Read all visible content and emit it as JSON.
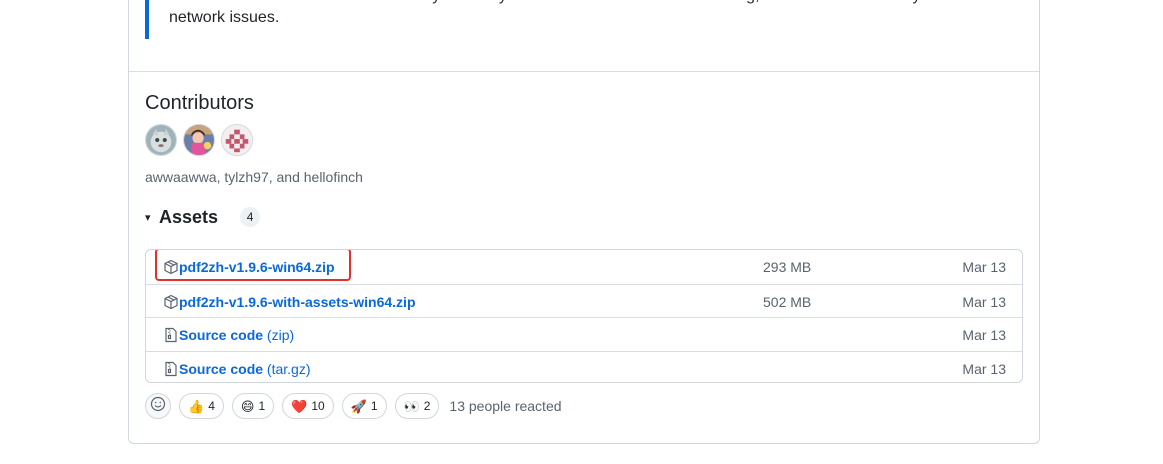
{
  "note": {
    "line1": "The version without assets will also dynamically download resources when running, but the download may fail due to",
    "line2": "network issues."
  },
  "contributors": {
    "title": "Contributors",
    "names": "awwaawwa, tylzh97, and hellofinch",
    "avatars": [
      "awwaawwa",
      "tylzh97",
      "hellofinch"
    ]
  },
  "assets": {
    "caret": "▾",
    "title": "Assets",
    "count": "4",
    "items": [
      {
        "name": "pdf2zh-v1.9.6-win64.zip",
        "suffix": "",
        "size": "293 MB",
        "date": "Mar 13",
        "icon": "package-icon"
      },
      {
        "name": "pdf2zh-v1.9.6-with-assets-win64.zip",
        "suffix": "",
        "size": "502 MB",
        "date": "Mar 13",
        "icon": "package-icon"
      },
      {
        "name": "Source code",
        "suffix": "(zip)",
        "size": "",
        "date": "Mar 13",
        "icon": "file-zip-icon"
      },
      {
        "name": "Source code",
        "suffix": "(tar.gz)",
        "size": "",
        "date": "Mar 13",
        "icon": "file-zip-icon"
      }
    ]
  },
  "reactions": {
    "items": [
      {
        "emoji": "👍",
        "count": "4"
      },
      {
        "emoji": "😄",
        "count": "1"
      },
      {
        "emoji": "❤️",
        "count": "10"
      },
      {
        "emoji": "🚀",
        "count": "1"
      },
      {
        "emoji": "👀",
        "count": "2"
      }
    ],
    "summary": "13 people reacted"
  },
  "colors": {
    "link": "#0969da",
    "highlight": "#e0322a",
    "border": "#d0d7de",
    "muted": "#59636e"
  }
}
